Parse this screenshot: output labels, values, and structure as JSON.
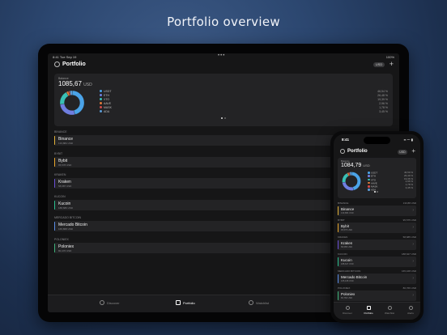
{
  "headline": "Portfolio overview",
  "colors": {
    "usdt": "#4aa3e8",
    "eth": "#6f7ee0",
    "xto": "#39c0b5",
    "aave": "#e07b39",
    "mask": "#d14a4a",
    "ada": "#5b9bd5",
    "binance": "#e2b23a",
    "bybit": "#e8a72c",
    "kraken": "#6a4fd6",
    "kucoin": "#2bbf8e",
    "mercado": "#5a8de8",
    "poloniex": "#3fb37a"
  },
  "tablet": {
    "status": {
      "time": "8:41",
      "date": "Tue Sep 19",
      "dots": "•••",
      "battery": "100%"
    },
    "title": "Portfolio",
    "currency": "USD",
    "summary": {
      "label": "Balance",
      "value": "1085,67",
      "currency": "USD",
      "legend": [
        {
          "name": "USDT",
          "pct": "46,54 %",
          "color_key": "usdt"
        },
        {
          "name": "ETH",
          "pct": "26,48 %",
          "color_key": "eth"
        },
        {
          "name": "XTO",
          "pct": "19,39 %",
          "color_key": "xto"
        },
        {
          "name": "AAVE",
          "pct": "2,96 %",
          "color_key": "aave"
        },
        {
          "name": "MASK",
          "pct": "1,78 %",
          "color_key": "mask"
        },
        {
          "name": "ADA",
          "pct": "3,45 %",
          "color_key": "ada"
        }
      ]
    },
    "exchanges": [
      {
        "section": "BINANCE",
        "name": "Binance",
        "sub": "133,884 USD",
        "color_key": "binance"
      },
      {
        "section": "BYBIT",
        "name": "Bybit",
        "sub": "95,578 USD",
        "color_key": "bybit"
      },
      {
        "section": "KRAKEN",
        "name": "Kraken",
        "sub": "58,687 USD",
        "color_key": "kraken"
      },
      {
        "section": "KUCOIN",
        "name": "Kucoin",
        "sub": "188,686 USD",
        "color_key": "kucoin"
      },
      {
        "section": "MERCADO BITCOIN",
        "name": "Mercado Bitcoin",
        "sub": "165,868 USD",
        "color_key": "mercado"
      },
      {
        "section": "POLONIEX",
        "name": "Poloniex",
        "sub": "80,476 USD",
        "color_key": "poloniex"
      }
    ],
    "tabs": [
      "Discover",
      "Portfolio",
      "Watchlist"
    ]
  },
  "phone": {
    "status": {
      "time": "8:41",
      "right": "▪▪ 〜 ▮"
    },
    "title": "Portfolio",
    "currency": "USD",
    "summary": {
      "label": "Balance",
      "value": "1084,79",
      "currency": "USD",
      "legend": [
        {
          "name": "USDT",
          "pct": "46,59 %",
          "color_key": "usdt"
        },
        {
          "name": "ETH",
          "pct": "26,49 %",
          "color_key": "eth"
        },
        {
          "name": "XTO",
          "pct": "19,36 %",
          "color_key": "xto"
        },
        {
          "name": "AAVE",
          "pct": "2,96 %",
          "color_key": "aave"
        },
        {
          "name": "MASK",
          "pct": "1,78 %",
          "color_key": "mask"
        },
        {
          "name": "ADA",
          "pct": "3,45 %",
          "color_key": "ada"
        }
      ]
    },
    "exchanges": [
      {
        "section": "BINANCE",
        "amount": "133,88 USD",
        "name": "Binance",
        "sub": "133,884 USD",
        "color_key": "binance"
      },
      {
        "section": "BYBIT",
        "amount": "95,575 USD",
        "name": "Bybit",
        "sub": "95,575 USD",
        "color_key": "bybit"
      },
      {
        "section": "KRAKEN",
        "amount": "58,685 USD",
        "name": "Kraken",
        "sub": "58,685 USD",
        "color_key": "kraken"
      },
      {
        "section": "KUCOIN",
        "amount": "188,627 USD",
        "name": "Kucoin",
        "sub": "188,627 USD",
        "color_key": "kucoin"
      },
      {
        "section": "MERCADO BITCOIN",
        "amount": "165,168 USD",
        "name": "Mercado Bitcoin",
        "sub": "165,168 USD",
        "color_key": "mercado"
      },
      {
        "section": "POLONIEX",
        "amount": "80,766 USD",
        "name": "Poloniex",
        "sub": "80,766 USD",
        "color_key": "poloniex"
      }
    ],
    "tabs": [
      "Discover",
      "Portfolio",
      "Watchlist",
      "Alerts"
    ]
  }
}
